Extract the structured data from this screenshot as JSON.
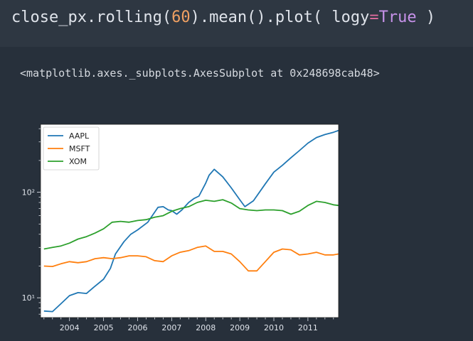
{
  "code_cell": {
    "parts": [
      {
        "text": "close_px.rolling(",
        "style": "plain"
      },
      {
        "text": "60",
        "style": "num"
      },
      {
        "text": ").mean().plot( logy",
        "style": "plain"
      },
      {
        "text": "=",
        "style": "op"
      },
      {
        "text": "True",
        "style": "const"
      },
      {
        "text": " )",
        "style": "plain"
      }
    ]
  },
  "output": {
    "text": "<matplotlib.axes._subplots.AxesSubplot at 0x248698cab48>"
  },
  "chart_data": {
    "type": "line",
    "logy": true,
    "x_tick_labels": [
      "2004",
      "2005",
      "2006",
      "2007",
      "2008",
      "2009",
      "2010",
      "2011"
    ],
    "x_ticks": [
      2004,
      2005,
      2006,
      2007,
      2008,
      2009,
      2010,
      2011
    ],
    "y_tick_labels": [
      "10¹",
      "10²"
    ],
    "y_ticks": [
      10,
      100
    ],
    "xlim": [
      2003.15,
      2011.9
    ],
    "ylim": [
      6.5,
      440
    ],
    "legend_position": "upper-left",
    "series": [
      {
        "name": "AAPL",
        "color": "#1f77b4",
        "points": [
          [
            2003.25,
            7.5
          ],
          [
            2003.5,
            7.4
          ],
          [
            2003.75,
            8.8
          ],
          [
            2004.0,
            10.5
          ],
          [
            2004.25,
            11.2
          ],
          [
            2004.5,
            11.0
          ],
          [
            2004.7,
            12.5
          ],
          [
            2005.0,
            15.0
          ],
          [
            2005.2,
            19.0
          ],
          [
            2005.35,
            26.0
          ],
          [
            2005.6,
            34.0
          ],
          [
            2005.8,
            40.0
          ],
          [
            2006.0,
            44.0
          ],
          [
            2006.3,
            52.0
          ],
          [
            2006.6,
            72.0
          ],
          [
            2006.75,
            73.0
          ],
          [
            2006.9,
            68.0
          ],
          [
            2007.0,
            67.0
          ],
          [
            2007.15,
            62.0
          ],
          [
            2007.3,
            68.0
          ],
          [
            2007.5,
            80.0
          ],
          [
            2007.65,
            87.0
          ],
          [
            2007.8,
            92.0
          ],
          [
            2008.0,
            122.0
          ],
          [
            2008.1,
            145.0
          ],
          [
            2008.25,
            165.0
          ],
          [
            2008.5,
            140.0
          ],
          [
            2008.75,
            110.0
          ],
          [
            2009.0,
            85.0
          ],
          [
            2009.15,
            73.0
          ],
          [
            2009.4,
            83.0
          ],
          [
            2009.75,
            120.0
          ],
          [
            2010.0,
            155.0
          ],
          [
            2010.25,
            180.0
          ],
          [
            2010.5,
            212.0
          ],
          [
            2010.75,
            248.0
          ],
          [
            2011.0,
            292.0
          ],
          [
            2011.25,
            330.0
          ],
          [
            2011.5,
            352.0
          ],
          [
            2011.75,
            370.0
          ],
          [
            2011.9,
            385.0
          ]
        ]
      },
      {
        "name": "MSFT",
        "color": "#ff7f0e",
        "points": [
          [
            2003.25,
            20.0
          ],
          [
            2003.5,
            19.8
          ],
          [
            2003.75,
            21.0
          ],
          [
            2004.0,
            22.0
          ],
          [
            2004.25,
            21.5
          ],
          [
            2004.5,
            22.0
          ],
          [
            2004.75,
            23.5
          ],
          [
            2005.0,
            24.0
          ],
          [
            2005.25,
            23.5
          ],
          [
            2005.5,
            24.0
          ],
          [
            2005.75,
            25.0
          ],
          [
            2006.0,
            25.0
          ],
          [
            2006.25,
            24.5
          ],
          [
            2006.5,
            22.5
          ],
          [
            2006.75,
            22.0
          ],
          [
            2007.0,
            25.0
          ],
          [
            2007.25,
            27.0
          ],
          [
            2007.5,
            28.0
          ],
          [
            2007.75,
            30.0
          ],
          [
            2008.0,
            31.0
          ],
          [
            2008.25,
            27.5
          ],
          [
            2008.5,
            27.5
          ],
          [
            2008.75,
            26.0
          ],
          [
            2009.0,
            22.0
          ],
          [
            2009.25,
            18.0
          ],
          [
            2009.5,
            18.0
          ],
          [
            2009.75,
            22.0
          ],
          [
            2010.0,
            27.0
          ],
          [
            2010.25,
            29.0
          ],
          [
            2010.5,
            28.5
          ],
          [
            2010.75,
            25.5
          ],
          [
            2011.0,
            26.0
          ],
          [
            2011.25,
            27.0
          ],
          [
            2011.5,
            25.5
          ],
          [
            2011.75,
            25.5
          ],
          [
            2011.9,
            26.0
          ]
        ]
      },
      {
        "name": "XOM",
        "color": "#2ca02c",
        "points": [
          [
            2003.25,
            29.0
          ],
          [
            2003.5,
            30.0
          ],
          [
            2003.75,
            31.0
          ],
          [
            2004.0,
            33.0
          ],
          [
            2004.25,
            36.0
          ],
          [
            2004.5,
            38.0
          ],
          [
            2004.75,
            41.0
          ],
          [
            2005.0,
            45.0
          ],
          [
            2005.25,
            52.0
          ],
          [
            2005.5,
            53.0
          ],
          [
            2005.75,
            52.0
          ],
          [
            2006.0,
            54.0
          ],
          [
            2006.25,
            55.0
          ],
          [
            2006.5,
            58.0
          ],
          [
            2006.75,
            60.0
          ],
          [
            2007.0,
            66.0
          ],
          [
            2007.25,
            70.0
          ],
          [
            2007.5,
            73.0
          ],
          [
            2007.75,
            80.0
          ],
          [
            2008.0,
            84.0
          ],
          [
            2008.25,
            82.0
          ],
          [
            2008.5,
            85.0
          ],
          [
            2008.75,
            79.0
          ],
          [
            2009.0,
            70.0
          ],
          [
            2009.25,
            68.0
          ],
          [
            2009.5,
            67.0
          ],
          [
            2009.75,
            68.0
          ],
          [
            2010.0,
            68.0
          ],
          [
            2010.25,
            67.0
          ],
          [
            2010.5,
            62.0
          ],
          [
            2010.75,
            66.0
          ],
          [
            2011.0,
            75.0
          ],
          [
            2011.25,
            82.0
          ],
          [
            2011.5,
            80.0
          ],
          [
            2011.75,
            76.0
          ],
          [
            2011.9,
            75.0
          ]
        ]
      }
    ]
  }
}
